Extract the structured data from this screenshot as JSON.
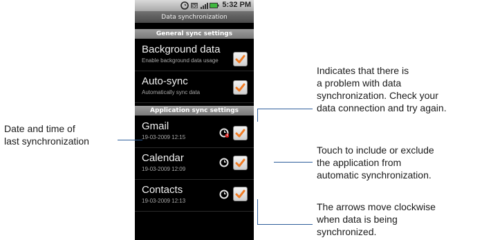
{
  "status_bar": {
    "time": "5:32 PM"
  },
  "title_bar": {
    "title": "Data synchronization"
  },
  "general_header": "General sync settings",
  "general_settings": [
    {
      "title": "Background data",
      "subtitle": "Enable background data usage",
      "checked": true
    },
    {
      "title": "Auto-sync",
      "subtitle": "Automatically sync data",
      "checked": true
    }
  ],
  "app_header": "Application sync settings",
  "app_settings": [
    {
      "title": "Gmail",
      "subtitle": "19-03-2009 12:15",
      "checked": true,
      "sync_status": "error"
    },
    {
      "title": "Calendar",
      "subtitle": "19-03-2009 12:09",
      "checked": true,
      "sync_status": "ok"
    },
    {
      "title": "Contacts",
      "subtitle": "19-03-2009 12:13",
      "checked": true,
      "sync_status": "ok"
    }
  ],
  "callouts": {
    "last_sync_line1": "Date and time of",
    "last_sync_line2": "last synchronization",
    "problem_line1": "Indicates that there is",
    "problem_line2": "a problem with data",
    "problem_line3": "synchronization. Check your",
    "problem_line4": "data connection and try again.",
    "toggle_line1": "Touch to include or exclude",
    "toggle_line2": "the application from",
    "toggle_line3": "automatic synchronization.",
    "arrows_line1": "The arrows move clockwise",
    "arrows_line2": "when data is being",
    "arrows_line3": "synchronized."
  },
  "colors": {
    "check": "#f07a22",
    "callout_line": "#2d5d9a"
  }
}
